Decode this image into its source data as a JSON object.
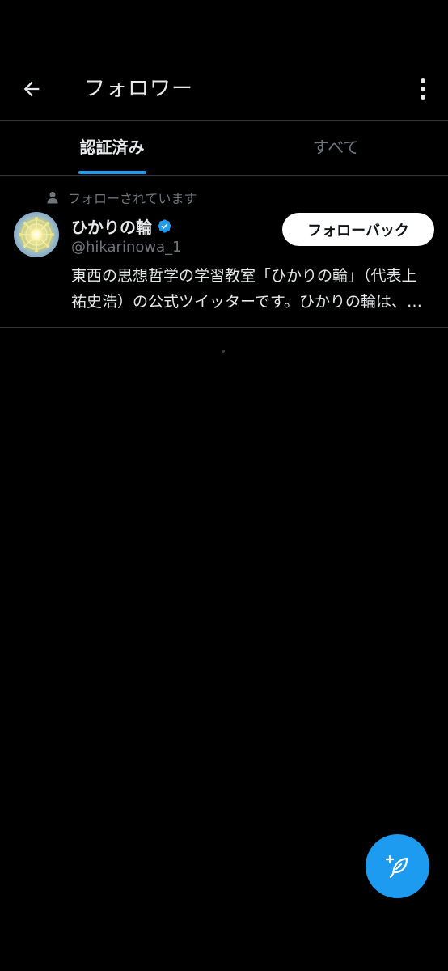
{
  "header": {
    "title": "フォロワー",
    "back_icon": "arrow-left-icon",
    "more_icon": "more-vertical-icon"
  },
  "tabs": [
    {
      "label": "認証済み",
      "active": true
    },
    {
      "label": "すべて",
      "active": false
    }
  ],
  "followers": [
    {
      "follows_you_label": "フォローされています",
      "display_name": "ひかりの輪",
      "verified": true,
      "handle": "@hikarinowa_1",
      "bio": "東西の思想哲学の学習教室「ひかりの輪」（代表上祐史浩）の公式ツイッターです。ひかりの輪は、特定の宗教・思想にとらわれず",
      "follow_back_label": "フォローバック"
    }
  ],
  "fab": {
    "icon": "compose-feather-icon"
  },
  "colors": {
    "background": "#000000",
    "accent": "#1d9bf0",
    "text_primary": "#e7e9ea",
    "text_secondary": "#71767b",
    "divider": "#2f3336",
    "button_bg": "#ffffff",
    "button_text": "#0f1419"
  }
}
